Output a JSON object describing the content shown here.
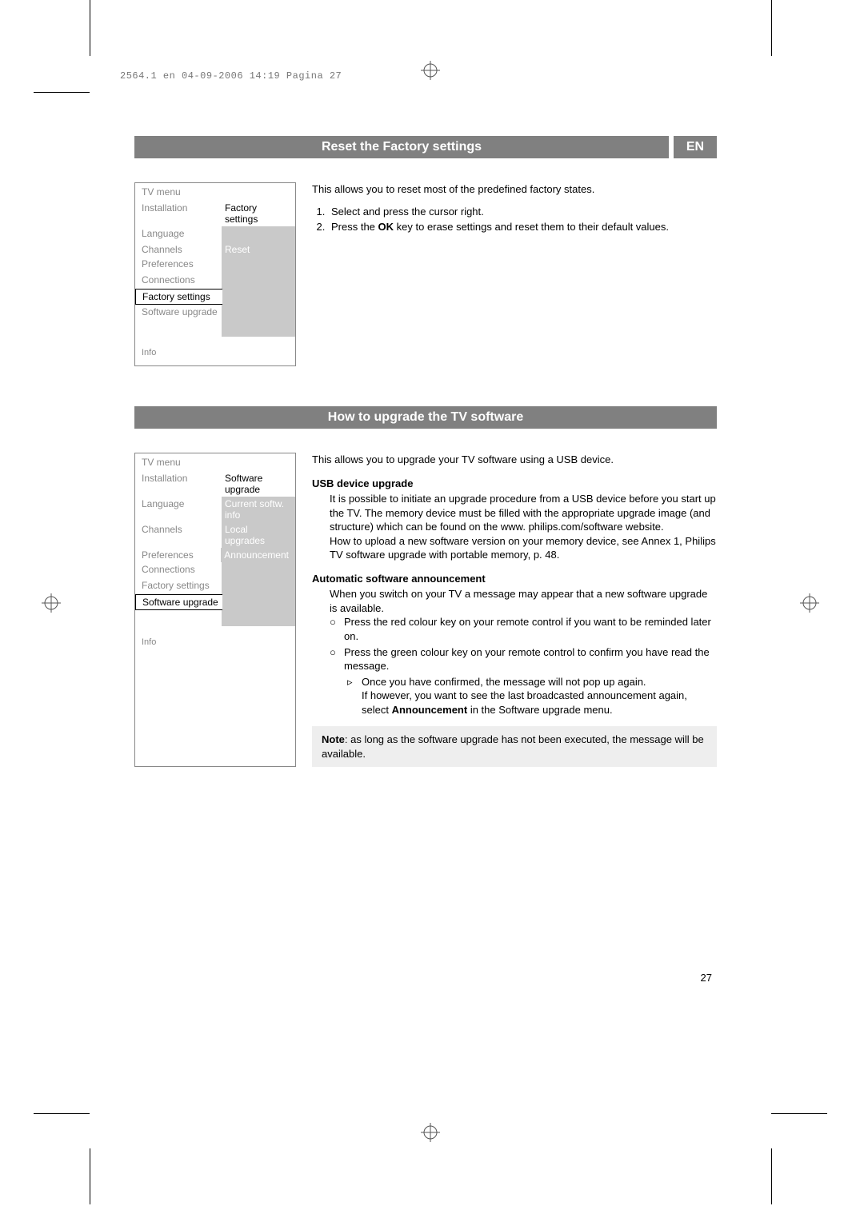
{
  "header_line": "2564.1 en  04-09-2006  14:19  Pagina 27",
  "section1": {
    "title": "Reset the Factory settings",
    "lang": "EN",
    "menu": {
      "title": "TV menu",
      "left_heading": "Installation",
      "right_heading": "Factory settings",
      "items_left": [
        "Language",
        "Channels",
        "Preferences",
        "Connections",
        "Factory settings",
        "Software upgrade"
      ],
      "items_right": [
        "",
        "Reset",
        "",
        "",
        "",
        ""
      ],
      "selected_left_index": 4,
      "info": "Info"
    },
    "intro": "This allows you to reset most of the predefined factory states.",
    "steps": [
      "Select and press the cursor right.",
      "Press the OK key to erase settings and reset them to their default values."
    ],
    "step2_pre": "Press the ",
    "step2_bold": "OK",
    "step2_post": " key to erase settings and reset them to their default values."
  },
  "section2": {
    "title": "How to upgrade the TV software",
    "menu": {
      "title": "TV menu",
      "left_heading": "Installation",
      "right_heading": "Software upgrade",
      "items_left": [
        "Language",
        "Channels",
        "Preferences",
        "Connections",
        "Factory settings",
        "Software upgrade"
      ],
      "items_right": [
        "Current softw. info",
        "Local upgrades",
        "Announcement",
        "",
        "",
        ""
      ],
      "selected_left_index": 5,
      "info": "Info"
    },
    "intro": "This allows you to upgrade your TV software using a USB device.",
    "usb_heading": "USB device upgrade",
    "usb_p1": "It is possible to initiate an upgrade procedure from a USB device before you start up the TV. The memory device must be filled with the appropriate upgrade image (and structure) which can be found on the www. philips.com/software website.",
    "usb_p2": "How to upload a new software version on your memory device, see Annex 1, Philips TV software upgrade with portable memory, p. 48.",
    "auto_heading": "Automatic software announcement",
    "auto_intro": "When you switch on your TV a message may appear that a new software upgrade is available.",
    "auto_b1": "Press the red colour key on your remote control if you want to be reminded later on.",
    "auto_b2": "Press the green colour key on your remote control to confirm you have read the message.",
    "auto_sub_pre": "Once you have confirmed, the message will not pop up again.",
    "auto_sub_post_pre": "If however, you want to see the last broadcasted announcement again, select ",
    "auto_sub_bold": "Announcement",
    "auto_sub_post_post": " in the Software upgrade menu.",
    "note_bold": "Note",
    "note_text": ": as long as the software upgrade has not been executed, the message will be available."
  },
  "page_number": "27"
}
